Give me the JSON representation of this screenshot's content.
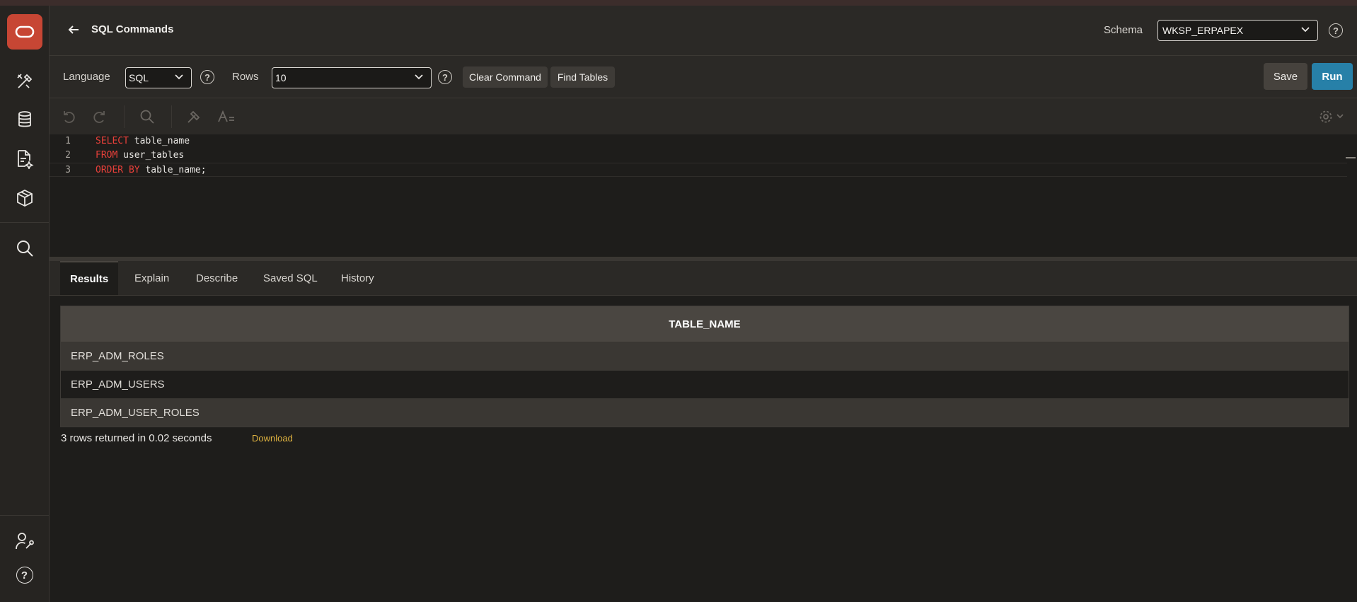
{
  "header": {
    "title": "SQL Commands",
    "schema_label": "Schema",
    "schema_value": "WKSP_ERPAPEX",
    "help_glyph": "?"
  },
  "toolbar": {
    "language_label": "Language",
    "language_value": "SQL",
    "rows_label": "Rows",
    "rows_value": "10",
    "clear_label": "Clear Command",
    "find_tables_label": "Find Tables",
    "save_label": "Save",
    "run_label": "Run"
  },
  "editor": {
    "lines": [
      {
        "num": "1",
        "kw": "SELECT",
        "rest": " table_name"
      },
      {
        "num": "2",
        "kw": "FROM",
        "rest": " user_tables"
      },
      {
        "num": "3",
        "kw": "ORDER BY",
        "rest": " table_name;"
      }
    ]
  },
  "tabs": [
    {
      "label": "Results"
    },
    {
      "label": "Explain"
    },
    {
      "label": "Describe"
    },
    {
      "label": "Saved SQL"
    },
    {
      "label": "History"
    }
  ],
  "results": {
    "column": "TABLE_NAME",
    "rows": [
      "ERP_ADM_ROLES",
      "ERP_ADM_USERS",
      "ERP_ADM_USER_ROLES"
    ],
    "status": "3 rows returned in 0.02 seconds",
    "download_label": "Download"
  },
  "colors": {
    "run_button": "#2780a8",
    "logo": "#c74634",
    "keyword": "#e8403a",
    "download_link": "#e0b440"
  },
  "nav_icons": [
    "oracle-logo-icon",
    "app-builder-icon",
    "database-icon",
    "document-sparkle-icon",
    "package-icon",
    "search-icon",
    "user-settings-icon",
    "help-icon"
  ]
}
